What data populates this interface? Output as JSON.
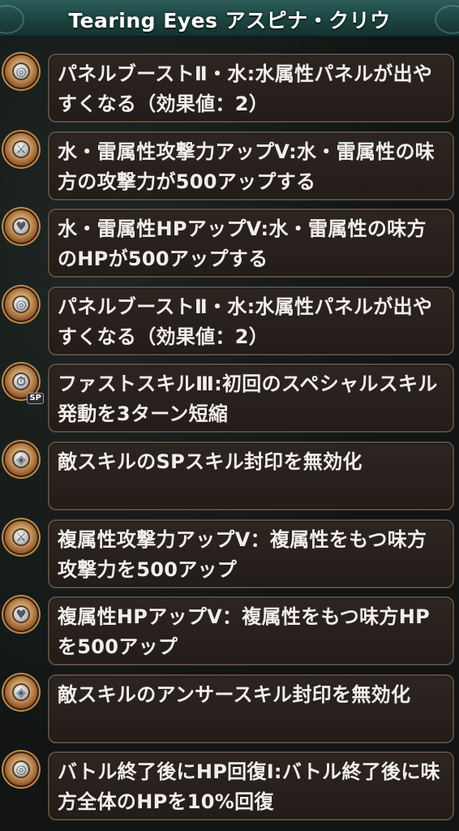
{
  "header": {
    "title": "Tearing Eyes アスピナ・クリウ"
  },
  "abilities": [
    {
      "icon": "water-panel-icon",
      "glyph": "◎",
      "text": "パネルブーストⅡ・水:水属性パネルが出やすくなる（効果値：2）"
    },
    {
      "icon": "attack-up-icon",
      "glyph": "⚔",
      "text": "水・雷属性攻撃力アップV:水・雷属性の味方の攻撃力が500アップする"
    },
    {
      "icon": "hp-up-icon",
      "glyph": "♥",
      "text": "水・雷属性HPアップV:水・雷属性の味方のHPが500アップする"
    },
    {
      "icon": "water-panel-icon",
      "glyph": "◎",
      "text": "パネルブーストⅡ・水:水属性パネルが出やすくなる（効果値：2）"
    },
    {
      "icon": "skill-charge-icon",
      "glyph": "⏱",
      "badge": "SP",
      "text": "ファストスキルⅢ:初回のスペシャルスキル発動を3ターン短縮"
    },
    {
      "icon": "seal-nullify-icon",
      "glyph": "◈",
      "text": "敵スキルのSPスキル封印を無効化"
    },
    {
      "icon": "attack-up-icon",
      "glyph": "⚔",
      "text": "複属性攻撃力アップV：複属性をもつ味方攻撃力を500アップ"
    },
    {
      "icon": "hp-up-icon",
      "glyph": "♥",
      "text": "複属性HPアップV：複属性をもつ味方HPを500アップ"
    },
    {
      "icon": "seal-nullify-icon",
      "glyph": "◈",
      "text": "敵スキルのアンサースキル封印を無効化"
    },
    {
      "icon": "hp-recover-icon",
      "glyph": "◎",
      "text": "バトル終了後にHP回復Ⅰ:バトル終了後に味方全体のHPを10%回復"
    }
  ]
}
